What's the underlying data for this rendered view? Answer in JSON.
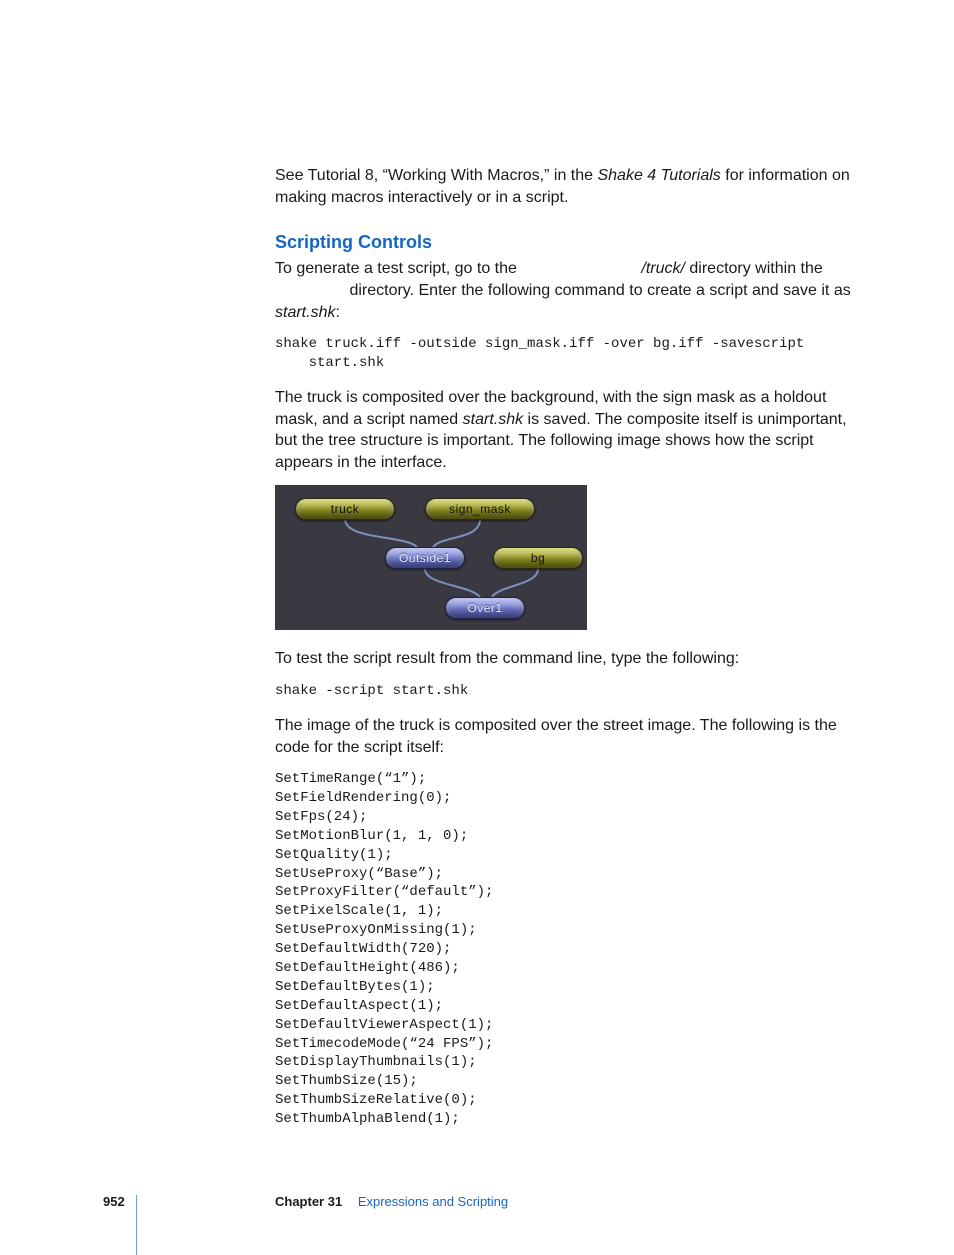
{
  "intro": {
    "prefix": "See Tutorial 8, “Working With Macros,” in the ",
    "doc_title": "Shake 4 Tutorials",
    "suffix": " for information on making macros interactively or in a script."
  },
  "heading": "Scripting Controls",
  "p1": {
    "a": "To generate a test script, go to the ",
    "truck": "/truck/",
    "b": " directory within the ",
    "c": " directory. Enter the following command to create a script and save it as ",
    "file": "start.shk",
    "d": ":"
  },
  "code1": "shake truck.iff -outside sign_mask.iff -over bg.iff -savescript \n    start.shk",
  "p2": {
    "a": "The truck is composited over the background, with the sign mask as a holdout mask, and a script named ",
    "file": "start.shk",
    "b": " is saved. The composite itself is unimportant, but the tree structure is important. The following image shows how the script appears in the interface."
  },
  "nodes": {
    "truck": "truck",
    "sign_mask": "sign_mask",
    "outside": "Outside1",
    "bg": "bg",
    "over": "Over1"
  },
  "p3": "To test the script result from the command line, type the following:",
  "code2": "shake -script start.shk",
  "p4": "The image of the truck is composited over the street image. The following is the code for the script itself:",
  "code3": "SetTimeRange(“1”);\nSetFieldRendering(0);\nSetFps(24);\nSetMotionBlur(1, 1, 0);\nSetQuality(1);\nSetUseProxy(“Base”);\nSetProxyFilter(“default”);\nSetPixelScale(1, 1);\nSetUseProxyOnMissing(1);\nSetDefaultWidth(720);\nSetDefaultHeight(486);\nSetDefaultBytes(1);\nSetDefaultAspect(1);\nSetDefaultViewerAspect(1);\nSetTimecodeMode(“24 FPS”);\nSetDisplayThumbnails(1);\nSetThumbSize(15);\nSetThumbSizeRelative(0);\nSetThumbAlphaBlend(1);",
  "footer": {
    "page": "952",
    "chapter_label": "Chapter 31",
    "chapter_title": "Expressions and Scripting"
  }
}
